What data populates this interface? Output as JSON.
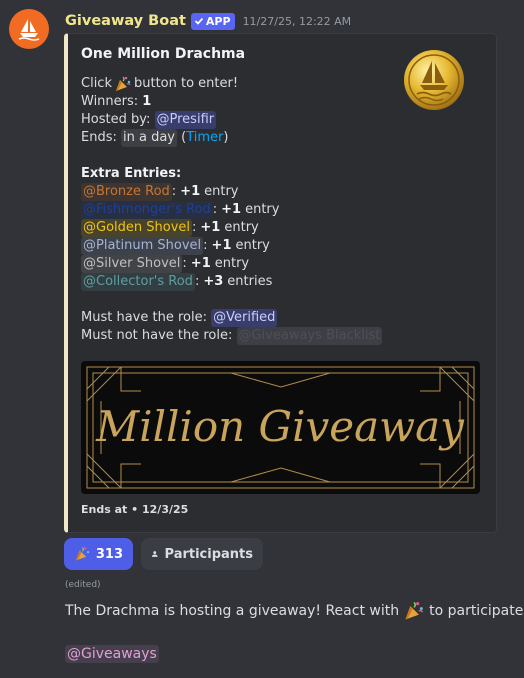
{
  "message": {
    "author": "Giveaway Boat",
    "badge": "APP",
    "timestamp": "11/27/25, 12:22 AM",
    "edited": "(edited)",
    "text_before": "The Drachma is hosting a giveaway! React with",
    "text_after": "to participate!",
    "mention_role": "@Giveaways"
  },
  "embed": {
    "title": "One Million Drachma",
    "click_before": "Click",
    "click_after": "button to enter!",
    "winners_label": "Winners:",
    "winners_value": "1",
    "hosted_label": "Hosted by:",
    "hosted_value": "@Presifir",
    "ends_label": "Ends:",
    "ends_value": "in a day",
    "timer_open": "(",
    "timer_link": "Timer",
    "timer_close": ")",
    "extra_heading": "Extra Entries:",
    "extra_entries": [
      {
        "role": "@Bronze Rod",
        "color": "#c87533",
        "bg": "rgba(200,117,51,0.12)",
        "sep": ":",
        "count": "+1",
        "unit": "entry"
      },
      {
        "role": "@Fishmonger's Rod",
        "color": "#1e3f9a",
        "bg": "rgba(30,63,154,0.15)",
        "sep": ":",
        "count": "+1",
        "unit": "entry"
      },
      {
        "role": "@Golden Shovel",
        "color": "#f1c40f",
        "bg": "rgba(241,196,15,0.15)",
        "sep": ":",
        "count": "+1",
        "unit": "entry"
      },
      {
        "role": "@Platinum Shovel",
        "color": "#a5b4d6",
        "bg": "rgba(165,180,214,0.15)",
        "sep": ":",
        "count": "+1",
        "unit": "entry"
      },
      {
        "role": "@Silver Shovel",
        "color": "#c0c0c0",
        "bg": "rgba(192,192,192,0.15)",
        "sep": ":",
        "count": "+1",
        "unit": "entry"
      },
      {
        "role": "@Collector's Rod",
        "color": "#5f9ea0",
        "bg": "rgba(95,158,160,0.15)",
        "sep": ":",
        "count": "+3",
        "unit": "entries"
      }
    ],
    "must_have_label": "Must have the role:",
    "must_have_role": "@Verified",
    "must_not_label": "Must not have the role:",
    "must_not_role": "@Giveaways Blacklist",
    "banner_text": "Million Giveaway",
    "footer_label": "Ends at",
    "footer_sep": "•",
    "footer_date": "12/3/25"
  },
  "reactions": {
    "react_count": "313",
    "participants_label": "Participants"
  },
  "icons": {
    "avatar": "ship-icon",
    "badge": "checkmark-icon",
    "react": "party-popper-icon",
    "participants": "person-icon"
  },
  "colors": {
    "background": "#323339",
    "embed_bg": "#2b2d31",
    "accent": "#5865f2",
    "username": "#f0e68c"
  }
}
